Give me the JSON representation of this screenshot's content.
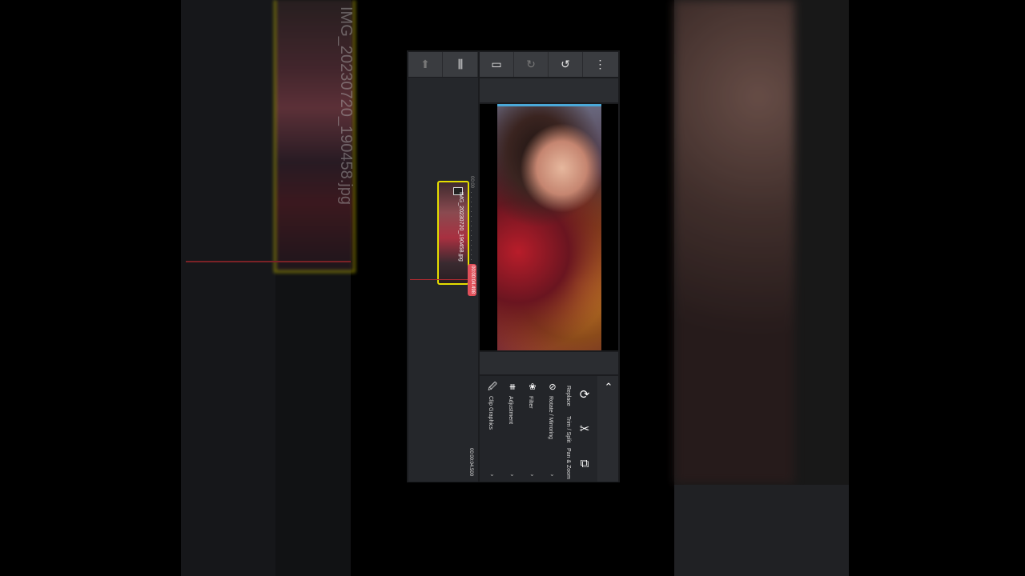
{
  "background": {
    "clip_filename": "IMG_20230720_190458.jpg"
  },
  "toolbar": {
    "left": [
      {
        "icon": "person-icon",
        "glyph": "⬆"
      },
      {
        "icon": "waveform-icon",
        "glyph": "⫼"
      }
    ],
    "right": [
      {
        "icon": "aspect-ratio-icon",
        "glyph": "▭"
      },
      {
        "icon": "redo-icon",
        "glyph": "↻"
      },
      {
        "icon": "undo-icon",
        "glyph": "↺"
      },
      {
        "icon": "more-icon",
        "glyph": "⋮"
      }
    ]
  },
  "timeline": {
    "clip_label": "IMG_20230720_190458.jpg",
    "start_time": "00:00",
    "playhead_time": "00:00:04.498",
    "total_time": "00:00:04.500"
  },
  "edit_menu": {
    "items": [
      {
        "label": "Clip Graphics",
        "icon": "clip-graphics-icon",
        "glyph": "🖉"
      },
      {
        "label": "Adjustment",
        "icon": "adjustment-icon",
        "glyph": "⧻"
      },
      {
        "label": "Filter",
        "icon": "filter-icon",
        "glyph": "❀"
      },
      {
        "label": "Rotate / Mirroring",
        "icon": "rotate-icon",
        "glyph": "⊘"
      }
    ],
    "side_items": [
      {
        "label": "Replace",
        "icon": "replace-icon",
        "glyph": "⟳"
      },
      {
        "label": "Trim / Split",
        "icon": "scissors-icon",
        "glyph": "✂"
      },
      {
        "label": "Pan & Zoom",
        "icon": "pan-zoom-icon",
        "glyph": "⧉"
      }
    ],
    "collapse_glyph": "⌃"
  }
}
